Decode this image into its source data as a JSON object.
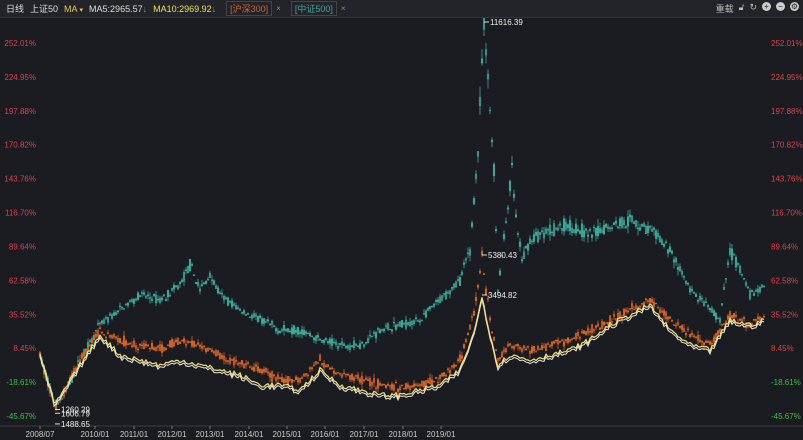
{
  "toolbar": {
    "period": "日线",
    "symbol": "上证50",
    "indicator": "MA",
    "ma5": "MA5:2965.57",
    "ma10": "MA10:2969.92",
    "arrow": "↓",
    "tag1": "[沪深300]",
    "tag2": "[中证500]",
    "close": "×",
    "right_label": "重载"
  },
  "colors": {
    "teal": "#3fa89a",
    "orange": "#d2642a",
    "yellow": "#f2e27a",
    "white": "#e8e8e8",
    "pos": "#d9434b",
    "neg": "#3cbf4a",
    "bg": "#1b1c21"
  },
  "chart_data": {
    "type": "candlestick",
    "ylabel_format": "percent",
    "ylim": [
      -45.67,
      252.01
    ],
    "yticks": [
      "252.01%",
      "224.95%",
      "197.88%",
      "170.82%",
      "143.76%",
      "116.70%",
      "89.64%",
      "62.58%",
      "35.52%",
      "8.45%",
      "-18.61%",
      "-45.67%"
    ],
    "ytick_values": [
      252.01,
      224.95,
      197.88,
      170.82,
      143.76,
      116.7,
      89.64,
      62.58,
      35.52,
      8.45,
      -18.61,
      -45.67
    ],
    "xlim": [
      0,
      725
    ],
    "xticks": [
      {
        "label": "2008/07",
        "x": 0
      },
      {
        "label": "2010/01",
        "x": 55
      },
      {
        "label": "2011/01",
        "x": 94
      },
      {
        "label": "2012/01",
        "x": 132
      },
      {
        "label": "2013/01",
        "x": 170
      },
      {
        "label": "2014/01",
        "x": 209
      },
      {
        "label": "2015/01",
        "x": 247
      },
      {
        "label": "2016/01",
        "x": 285
      },
      {
        "label": "2017/01",
        "x": 324
      },
      {
        "label": "2018/01",
        "x": 363
      },
      {
        "label": "2019/01",
        "x": 401
      }
    ],
    "series": [
      {
        "name": "中证500",
        "color": "teal",
        "style": "candle",
        "points": [
          [
            0,
            3
          ],
          [
            15,
            -36.9
          ],
          [
            25,
            -28.9
          ],
          [
            40,
            -1
          ],
          [
            60,
            27
          ],
          [
            80,
            38.9
          ],
          [
            100,
            50.9
          ],
          [
            120,
            46.9
          ],
          [
            140,
            58.9
          ],
          [
            150,
            74.8
          ],
          [
            160,
            54.9
          ],
          [
            170,
            66.9
          ],
          [
            180,
            50.9
          ],
          [
            200,
            38.9
          ],
          [
            220,
            30.9
          ],
          [
            240,
            23
          ],
          [
            260,
            23
          ],
          [
            280,
            15
          ],
          [
            300,
            11
          ],
          [
            320,
            11
          ],
          [
            340,
            23
          ],
          [
            360,
            27
          ],
          [
            380,
            30.9
          ],
          [
            400,
            46.9
          ],
          [
            420,
            62.9
          ],
          [
            430,
            86.8
          ],
          [
            438,
            166.6
          ],
          [
            444,
            270.3
          ],
          [
            448,
            222.5
          ],
          [
            454,
            150.6
          ],
          [
            458,
            54.9
          ],
          [
            465,
            102.8
          ],
          [
            472,
            150.6
          ],
          [
            477,
            102.8
          ],
          [
            482,
            78.8
          ],
          [
            490,
            94.8
          ],
          [
            510,
            102.8
          ],
          [
            530,
            106.8
          ],
          [
            550,
            98.8
          ],
          [
            570,
            106.8
          ],
          [
            590,
            110.7
          ],
          [
            610,
            102.8
          ],
          [
            630,
            86.8
          ],
          [
            650,
            54.9
          ],
          [
            670,
            38.9
          ],
          [
            680,
            30.9
          ],
          [
            690,
            86.8
          ],
          [
            700,
            70.9
          ],
          [
            710,
            50.9
          ],
          [
            725,
            58.9
          ]
        ]
      },
      {
        "name": "沪深300",
        "color": "orange",
        "style": "candle",
        "points": [
          [
            0,
            3
          ],
          [
            15,
            -40.9
          ],
          [
            40,
            -1
          ],
          [
            60,
            23
          ],
          [
            80,
            15
          ],
          [
            100,
            11
          ],
          [
            120,
            7
          ],
          [
            140,
            15
          ],
          [
            160,
            11
          ],
          [
            180,
            3
          ],
          [
            200,
            -5
          ],
          [
            220,
            -9
          ],
          [
            240,
            -17
          ],
          [
            260,
            -17
          ],
          [
            280,
            -1
          ],
          [
            300,
            -13
          ],
          [
            320,
            -15.3
          ],
          [
            340,
            -20.9
          ],
          [
            360,
            -23.3
          ],
          [
            380,
            -20.9
          ],
          [
            400,
            -15.3
          ],
          [
            420,
            -1
          ],
          [
            435,
            38.9
          ],
          [
            442,
            82.8
          ],
          [
            446,
            54.9
          ],
          [
            452,
            23
          ],
          [
            458,
            -1
          ],
          [
            470,
            11
          ],
          [
            490,
            7
          ],
          [
            510,
            11
          ],
          [
            530,
            15
          ],
          [
            550,
            23
          ],
          [
            570,
            30.9
          ],
          [
            590,
            38.9
          ],
          [
            610,
            46.9
          ],
          [
            630,
            30.9
          ],
          [
            650,
            19
          ],
          [
            670,
            11
          ],
          [
            690,
            34.9
          ],
          [
            710,
            27
          ],
          [
            725,
            34.9
          ]
        ]
      },
      {
        "name": "上证50",
        "color": "yellow",
        "style": "line",
        "points": [
          [
            0,
            3
          ],
          [
            15,
            -36.9
          ],
          [
            40,
            -5
          ],
          [
            60,
            19
          ],
          [
            80,
            3
          ],
          [
            100,
            -1
          ],
          [
            120,
            -5
          ],
          [
            140,
            -1
          ],
          [
            160,
            -5
          ],
          [
            180,
            -9
          ],
          [
            200,
            -12.9
          ],
          [
            220,
            -20.9
          ],
          [
            240,
            -20.9
          ],
          [
            260,
            -24.9
          ],
          [
            280,
            -9
          ],
          [
            300,
            -20.9
          ],
          [
            320,
            -24.9
          ],
          [
            340,
            -28.9
          ],
          [
            360,
            -28.9
          ],
          [
            380,
            -24.9
          ],
          [
            400,
            -20.9
          ],
          [
            420,
            -9
          ],
          [
            435,
            23
          ],
          [
            442,
            50.9
          ],
          [
            450,
            19
          ],
          [
            458,
            -5
          ],
          [
            470,
            3
          ],
          [
            490,
            -1
          ],
          [
            510,
            3
          ],
          [
            530,
            7
          ],
          [
            550,
            15
          ],
          [
            570,
            27
          ],
          [
            590,
            34.9
          ],
          [
            610,
            42.9
          ],
          [
            630,
            23
          ],
          [
            650,
            11
          ],
          [
            670,
            7
          ],
          [
            690,
            30.9
          ],
          [
            710,
            27
          ],
          [
            725,
            30.9
          ]
        ]
      }
    ],
    "annotations": [
      {
        "text": "11616.39",
        "x": 444,
        "y": 270.3
      },
      {
        "text": "5380.43",
        "x": 442,
        "y": 82.8
      },
      {
        "text": "3494.82",
        "x": 442,
        "y": 50.9
      },
      {
        "text": "1260.29",
        "x": 15,
        "y": -40.5
      },
      {
        "text": "1606.79",
        "x": 15,
        "y": -43.5
      },
      {
        "text": "1488.65",
        "x": 15,
        "y": -52
      }
    ]
  }
}
